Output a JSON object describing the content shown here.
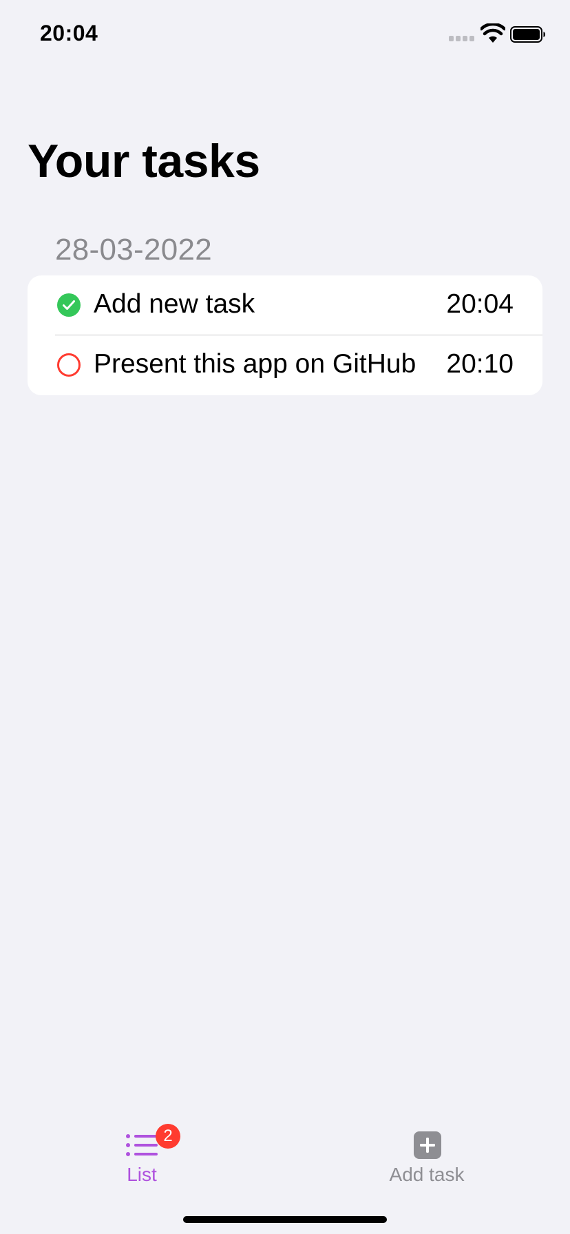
{
  "status_bar": {
    "time": "20:04"
  },
  "page": {
    "title": "Your tasks"
  },
  "sections": [
    {
      "header": "28-03-2022",
      "tasks": [
        {
          "title": "Add new task",
          "time": "20:04",
          "completed": true
        },
        {
          "title": "Present this app on GitHub",
          "time": "20:10",
          "completed": false
        }
      ]
    }
  ],
  "tab_bar": {
    "tabs": [
      {
        "label": "List",
        "icon": "list-icon",
        "badge": "2",
        "selected": true
      },
      {
        "label": "Add task",
        "icon": "plus-square-icon",
        "selected": false
      }
    ]
  },
  "colors": {
    "background": "#f2f2f7",
    "accent": "#af52de",
    "completed": "#34c759",
    "pending": "#ff3b30",
    "badge": "#ff3b30",
    "inactive_tab": "#8e8e93"
  }
}
